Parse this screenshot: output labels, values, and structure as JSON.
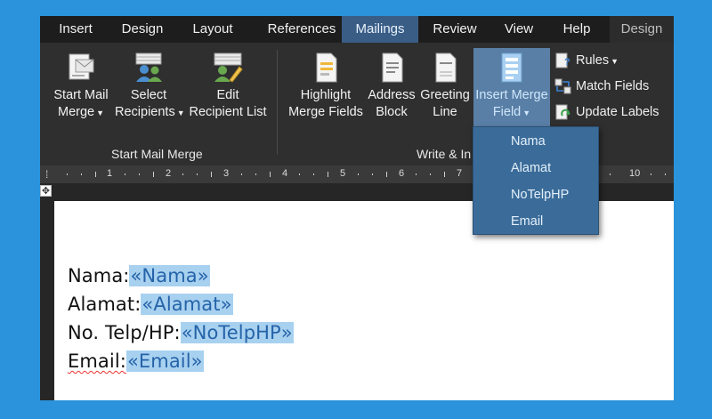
{
  "tabs": {
    "insert": "Insert",
    "design": "Design",
    "layout": "Layout",
    "references": "References",
    "mailings": "Mailings",
    "review": "Review",
    "view": "View",
    "help": "Help",
    "design_context": "Design"
  },
  "ribbon": {
    "start_mail_merge": {
      "line1": "Start Mail",
      "line2": "Merge"
    },
    "select_recipients": {
      "line1": "Select",
      "line2": "Recipients"
    },
    "edit_recipient_list": {
      "line1": "Edit",
      "line2": "Recipient List"
    },
    "highlight_merge_fields": {
      "line1": "Highlight",
      "line2": "Merge Fields"
    },
    "address_block": {
      "line1": "Address",
      "line2": "Block"
    },
    "greeting_line": {
      "line1": "Greeting",
      "line2": "Line"
    },
    "insert_merge_field": {
      "line1": "Insert Merge",
      "line2": "Field"
    },
    "rules": "Rules",
    "match_fields": "Match Fields",
    "update_labels": "Update Labels",
    "group_start_mail_merge": "Start Mail Merge",
    "group_write_insert": "Write & In"
  },
  "ruler": {
    "numbers": [
      "1",
      "2",
      "3",
      "4",
      "5",
      "6",
      "7",
      "10"
    ]
  },
  "dropdown": {
    "items": [
      "Nama",
      "Alamat",
      "NoTelpHP",
      "Email"
    ]
  },
  "document": {
    "lines": [
      {
        "label": "Nama:",
        "field": "«Nama»"
      },
      {
        "label": "Alamat:",
        "field": "«Alamat»"
      },
      {
        "label": "No. Telp/HP:",
        "field": "«NoTelpHP»"
      },
      {
        "label": "Email:",
        "field": "«Email»"
      }
    ]
  },
  "colors": {
    "background": "#2a93dc",
    "active_tab": "#3a5d86",
    "dropdown": "#3b6c99",
    "field_highlight": "#a8d1f0"
  },
  "icons": [
    "start-mail-merge-icon",
    "select-recipients-icon",
    "edit-recipient-list-icon",
    "highlight-merge-fields-icon",
    "address-block-icon",
    "greeting-line-icon",
    "insert-merge-field-icon",
    "rules-icon",
    "match-fields-icon",
    "update-labels-icon",
    "table-move-handle-icon"
  ]
}
